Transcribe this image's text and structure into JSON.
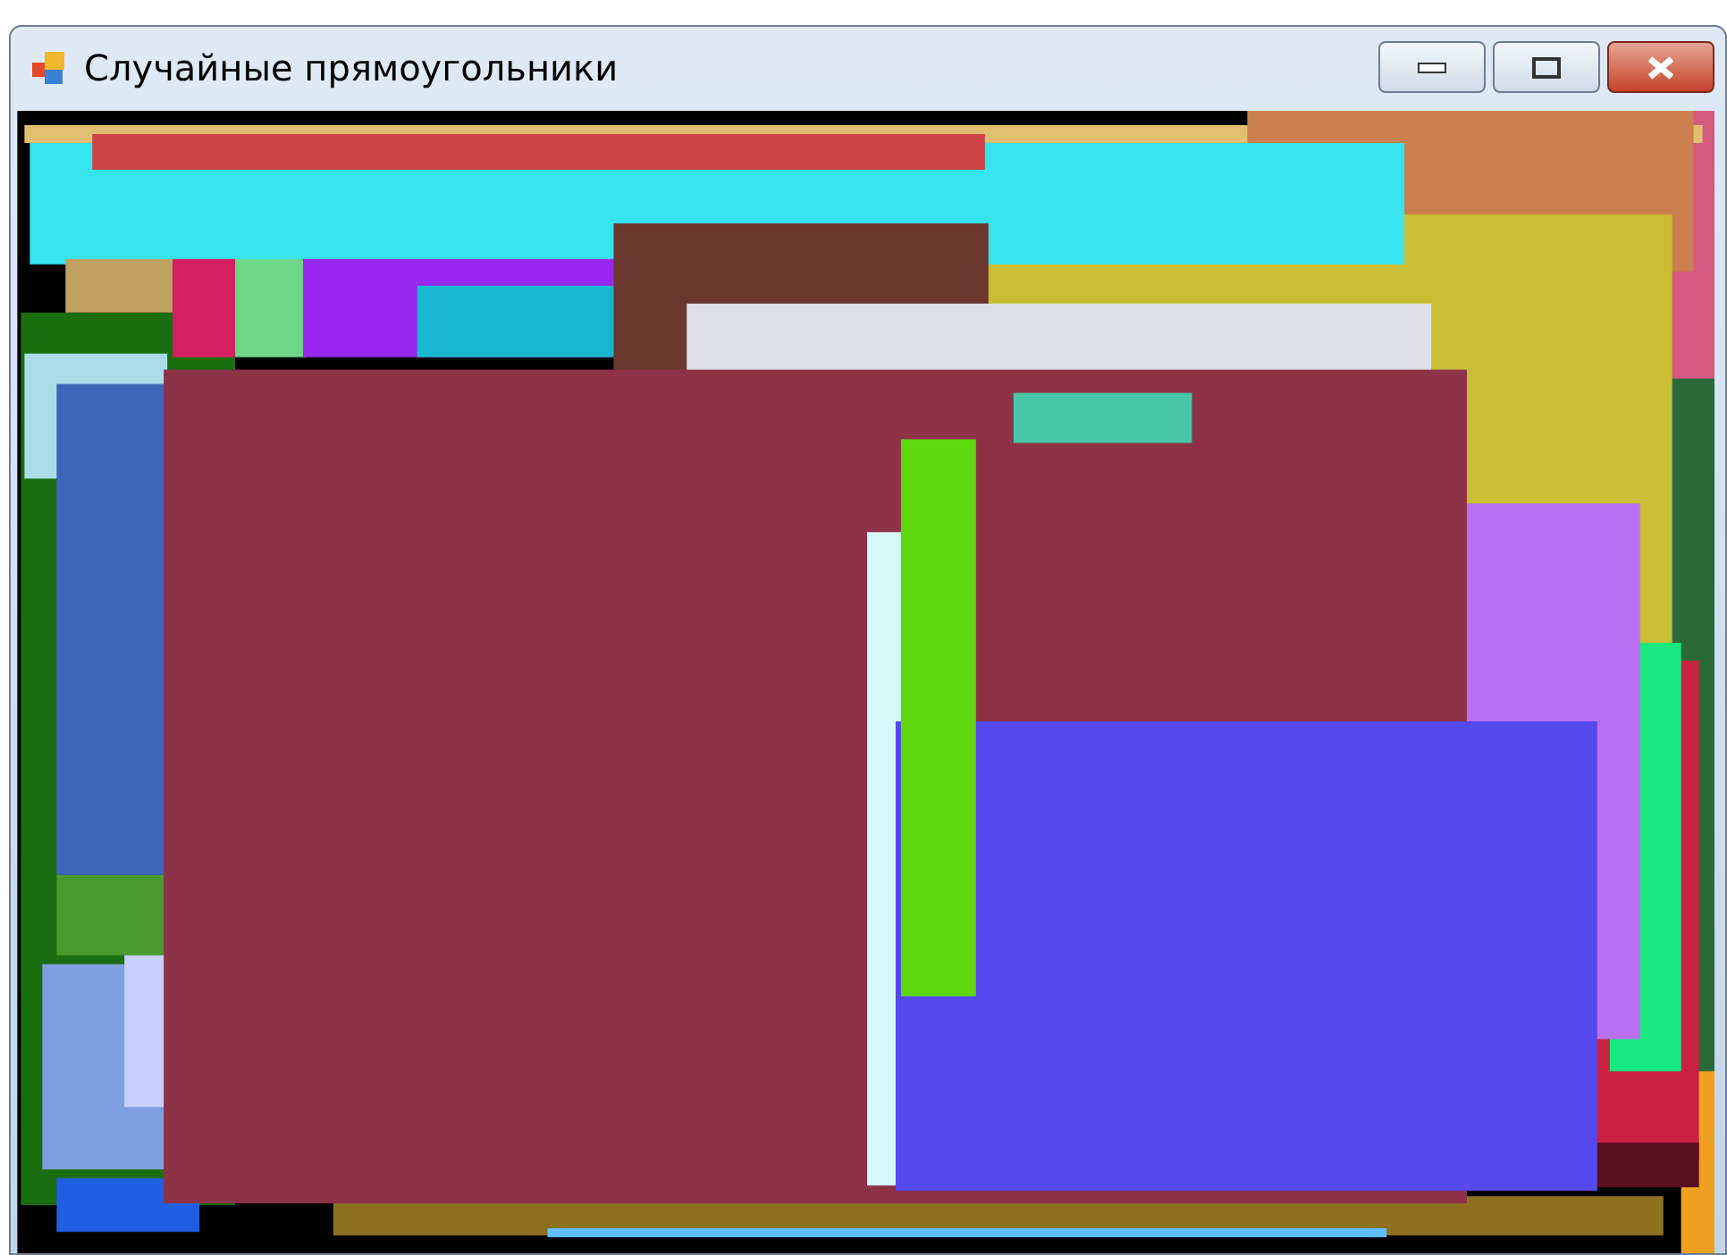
{
  "window": {
    "title": "Случайные прямоугольники"
  }
}
